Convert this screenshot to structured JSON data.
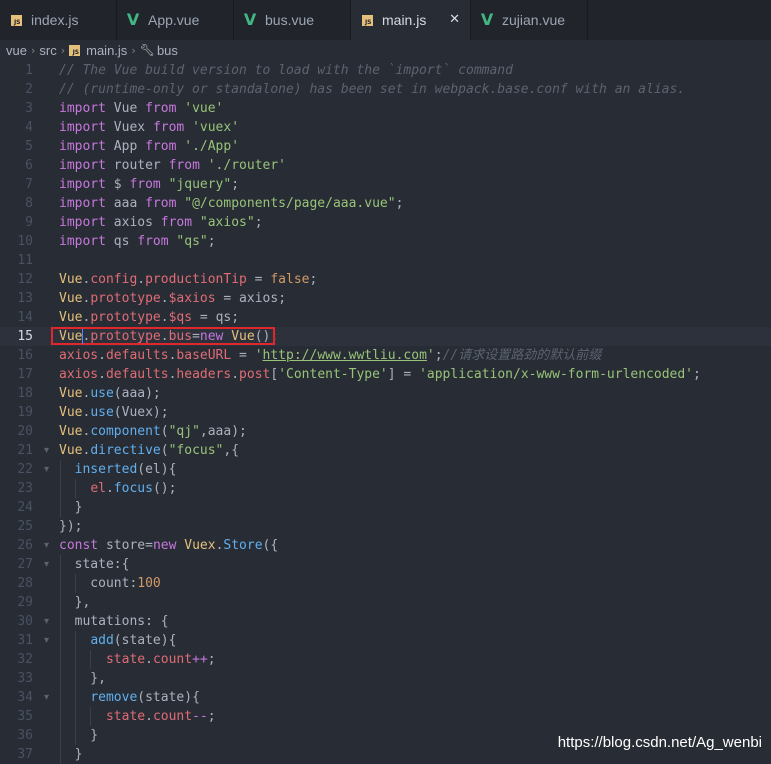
{
  "tabs": [
    {
      "label": "index.js",
      "icon": "js-icon"
    },
    {
      "label": "App.vue",
      "icon": "vue-icon"
    },
    {
      "label": "bus.vue",
      "icon": "vue-icon"
    },
    {
      "label": "main.js",
      "icon": "js-icon",
      "active": true,
      "close": "✕"
    },
    {
      "label": "zujian.vue",
      "icon": "vue-icon"
    }
  ],
  "breadcrumb": {
    "items": [
      "vue",
      "src",
      "main.js",
      "bus"
    ],
    "separator": "›"
  },
  "editor": {
    "current_line": 15,
    "lines": [
      {
        "n": "1",
        "fold": "",
        "t": [
          [
            "cm",
            "// The Vue build version to load with the `import` command"
          ]
        ]
      },
      {
        "n": "2",
        "fold": "",
        "t": [
          [
            "cm",
            "// (runtime-only or standalone) has been set in webpack.base.conf with an alias."
          ]
        ]
      },
      {
        "n": "3",
        "fold": "",
        "t": [
          [
            "kw",
            "import"
          ],
          [
            "var",
            " Vue "
          ],
          [
            "kw",
            "from"
          ],
          [
            "str",
            " 'vue'"
          ]
        ]
      },
      {
        "n": "4",
        "fold": "",
        "t": [
          [
            "kw",
            "import"
          ],
          [
            "var",
            " Vuex "
          ],
          [
            "kw",
            "from"
          ],
          [
            "str",
            " 'vuex'"
          ]
        ]
      },
      {
        "n": "5",
        "fold": "",
        "t": [
          [
            "kw",
            "import"
          ],
          [
            "var",
            " App "
          ],
          [
            "kw",
            "from"
          ],
          [
            "str",
            " './App'"
          ]
        ]
      },
      {
        "n": "6",
        "fold": "",
        "t": [
          [
            "kw",
            "import"
          ],
          [
            "var",
            " router "
          ],
          [
            "kw",
            "from"
          ],
          [
            "str",
            " './router'"
          ]
        ]
      },
      {
        "n": "7",
        "fold": "",
        "t": [
          [
            "kw",
            "import"
          ],
          [
            "var",
            " $ "
          ],
          [
            "kw",
            "from"
          ],
          [
            "str",
            " \"jquery\""
          ],
          [
            "punc",
            ";"
          ]
        ]
      },
      {
        "n": "8",
        "fold": "",
        "t": [
          [
            "kw",
            "import"
          ],
          [
            "var",
            " aaa "
          ],
          [
            "kw",
            "from"
          ],
          [
            "str",
            " \"@/components/page/aaa.vue\""
          ],
          [
            "punc",
            ";"
          ]
        ]
      },
      {
        "n": "9",
        "fold": "",
        "t": [
          [
            "kw",
            "import"
          ],
          [
            "var",
            " axios "
          ],
          [
            "kw",
            "from"
          ],
          [
            "str",
            " \"axios\""
          ],
          [
            "punc",
            ";"
          ]
        ]
      },
      {
        "n": "10",
        "fold": "",
        "t": [
          [
            "kw",
            "import"
          ],
          [
            "var",
            " qs "
          ],
          [
            "kw",
            "from"
          ],
          [
            "str",
            " \"qs\""
          ],
          [
            "punc",
            ";"
          ]
        ]
      },
      {
        "n": "11",
        "fold": "",
        "t": []
      },
      {
        "n": "12",
        "fold": "",
        "t": [
          [
            "obj",
            "Vue"
          ],
          [
            "punc",
            "."
          ],
          [
            "prop",
            "config"
          ],
          [
            "punc",
            "."
          ],
          [
            "prop",
            "productionTip"
          ],
          [
            "punc",
            " = "
          ],
          [
            "num",
            "false"
          ],
          [
            "punc",
            ";"
          ]
        ]
      },
      {
        "n": "13",
        "fold": "",
        "t": [
          [
            "obj",
            "Vue"
          ],
          [
            "punc",
            "."
          ],
          [
            "prop",
            "prototype"
          ],
          [
            "punc",
            "."
          ],
          [
            "prop",
            "$axios"
          ],
          [
            "punc",
            " = "
          ],
          [
            "var",
            "axios"
          ],
          [
            "punc",
            ";"
          ]
        ]
      },
      {
        "n": "14",
        "fold": "",
        "t": [
          [
            "obj",
            "Vue"
          ],
          [
            "punc",
            "."
          ],
          [
            "prop",
            "prototype"
          ],
          [
            "punc",
            "."
          ],
          [
            "prop",
            "$qs"
          ],
          [
            "punc",
            " = "
          ],
          [
            "var",
            "qs"
          ],
          [
            "punc",
            ";"
          ]
        ]
      },
      {
        "n": "15",
        "fold": "",
        "t": [
          [
            "obj",
            "Vue"
          ],
          [
            "punc",
            "."
          ],
          [
            "prop",
            "prototype"
          ],
          [
            "punc",
            "."
          ],
          [
            "prop",
            "bus"
          ],
          [
            "punc",
            "="
          ],
          [
            "kw",
            "new"
          ],
          [
            "obj",
            " Vue"
          ],
          [
            "punc",
            "();"
          ]
        ]
      },
      {
        "n": "16",
        "fold": "",
        "t": [
          [
            "prop",
            "axios"
          ],
          [
            "punc",
            "."
          ],
          [
            "prop",
            "defaults"
          ],
          [
            "punc",
            "."
          ],
          [
            "prop",
            "baseURL"
          ],
          [
            "punc",
            " = "
          ],
          [
            "str",
            "'"
          ],
          [
            "url",
            "http://www.wwtliu.com"
          ],
          [
            "str",
            "'"
          ],
          [
            "punc",
            ";"
          ],
          [
            "cm",
            "//请求设置路劲的默认前缀"
          ]
        ]
      },
      {
        "n": "17",
        "fold": "",
        "t": [
          [
            "prop",
            "axios"
          ],
          [
            "punc",
            "."
          ],
          [
            "prop",
            "defaults"
          ],
          [
            "punc",
            "."
          ],
          [
            "prop",
            "headers"
          ],
          [
            "punc",
            "."
          ],
          [
            "prop",
            "post"
          ],
          [
            "punc",
            "["
          ],
          [
            "str",
            "'Content-Type'"
          ],
          [
            "punc",
            "] = "
          ],
          [
            "str",
            "'application/x-www-form-urlencoded'"
          ],
          [
            "punc",
            ";"
          ]
        ]
      },
      {
        "n": "18",
        "fold": "",
        "t": [
          [
            "obj",
            "Vue"
          ],
          [
            "punc",
            "."
          ],
          [
            "fn",
            "use"
          ],
          [
            "punc",
            "(aaa);"
          ]
        ]
      },
      {
        "n": "19",
        "fold": "",
        "t": [
          [
            "obj",
            "Vue"
          ],
          [
            "punc",
            "."
          ],
          [
            "fn",
            "use"
          ],
          [
            "punc",
            "(Vuex);"
          ]
        ]
      },
      {
        "n": "20",
        "fold": "",
        "t": [
          [
            "obj",
            "Vue"
          ],
          [
            "punc",
            "."
          ],
          [
            "fn",
            "component"
          ],
          [
            "punc",
            "("
          ],
          [
            "str",
            "\"qj\""
          ],
          [
            "punc",
            ",aaa);"
          ]
        ]
      },
      {
        "n": "21",
        "fold": "▾",
        "t": [
          [
            "obj",
            "Vue"
          ],
          [
            "punc",
            "."
          ],
          [
            "fn",
            "directive"
          ],
          [
            "punc",
            "("
          ],
          [
            "str",
            "\"focus\""
          ],
          [
            "punc",
            ",{"
          ]
        ]
      },
      {
        "n": "22",
        "fold": "▾",
        "t": [
          [
            "var",
            "  "
          ],
          [
            "fn",
            "inserted"
          ],
          [
            "punc",
            "(el){"
          ]
        ]
      },
      {
        "n": "23",
        "fold": "",
        "t": [
          [
            "var",
            "    "
          ],
          [
            "prop",
            "el"
          ],
          [
            "punc",
            "."
          ],
          [
            "fn",
            "focus"
          ],
          [
            "punc",
            "();"
          ]
        ]
      },
      {
        "n": "24",
        "fold": "",
        "t": [
          [
            "punc",
            "  }"
          ]
        ]
      },
      {
        "n": "25",
        "fold": "",
        "t": [
          [
            "punc",
            "});"
          ]
        ]
      },
      {
        "n": "26",
        "fold": "▾",
        "t": [
          [
            "kw",
            "const"
          ],
          [
            "var",
            " store"
          ],
          [
            "punc",
            "="
          ],
          [
            "kw",
            "new"
          ],
          [
            "obj",
            " Vuex"
          ],
          [
            "punc",
            "."
          ],
          [
            "fn",
            "Store"
          ],
          [
            "punc",
            "({"
          ]
        ]
      },
      {
        "n": "27",
        "fold": "▾",
        "t": [
          [
            "var",
            "  state"
          ],
          [
            "punc",
            ":{"
          ]
        ]
      },
      {
        "n": "28",
        "fold": "",
        "t": [
          [
            "var",
            "    count"
          ],
          [
            "punc",
            ":"
          ],
          [
            "num",
            "100"
          ]
        ]
      },
      {
        "n": "29",
        "fold": "",
        "t": [
          [
            "punc",
            "  },"
          ]
        ]
      },
      {
        "n": "30",
        "fold": "▾",
        "t": [
          [
            "var",
            "  mutations"
          ],
          [
            "punc",
            ": {"
          ]
        ]
      },
      {
        "n": "31",
        "fold": "▾",
        "t": [
          [
            "var",
            "    "
          ],
          [
            "fn",
            "add"
          ],
          [
            "punc",
            "(state){"
          ]
        ]
      },
      {
        "n": "32",
        "fold": "",
        "t": [
          [
            "var",
            "      "
          ],
          [
            "prop",
            "state"
          ],
          [
            "punc",
            "."
          ],
          [
            "prop",
            "count"
          ],
          [
            "kw",
            "++"
          ],
          [
            "punc",
            ";"
          ]
        ]
      },
      {
        "n": "33",
        "fold": "",
        "t": [
          [
            "punc",
            "    },"
          ]
        ]
      },
      {
        "n": "34",
        "fold": "▾",
        "t": [
          [
            "var",
            "    "
          ],
          [
            "fn",
            "remove"
          ],
          [
            "punc",
            "(state){"
          ]
        ]
      },
      {
        "n": "35",
        "fold": "",
        "t": [
          [
            "var",
            "      "
          ],
          [
            "prop",
            "state"
          ],
          [
            "punc",
            "."
          ],
          [
            "prop",
            "count"
          ],
          [
            "kw",
            "--"
          ],
          [
            "punc",
            ";"
          ]
        ]
      },
      {
        "n": "36",
        "fold": "",
        "t": [
          [
            "punc",
            "    }"
          ]
        ]
      },
      {
        "n": "37",
        "fold": "",
        "t": [
          [
            "punc",
            "  }"
          ]
        ]
      }
    ]
  },
  "watermark": "https://blog.csdn.net/Ag_wenbi",
  "colors": {
    "background": "#282c34",
    "tabbar": "#21252b",
    "highlight_box": "#e0282c",
    "keyword": "#c678dd",
    "string": "#98c379",
    "comment": "#5c6370",
    "class": "#e5c07b",
    "function": "#61afef",
    "property": "#e06c75",
    "number": "#d19a66"
  }
}
